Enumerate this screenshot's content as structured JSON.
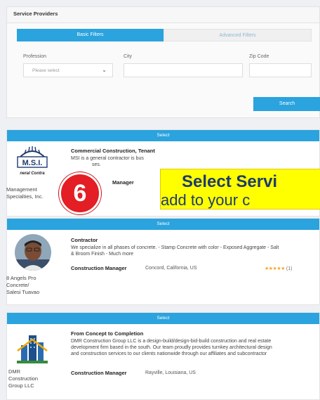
{
  "header": {
    "title": "Service Providers"
  },
  "filters": {
    "tabs": [
      "Basic Filters",
      "Advanced Filters"
    ],
    "labels": {
      "profession": "Profession",
      "city": "City",
      "zip": "Zip Code"
    },
    "profession_value": "Please select",
    "search_label": "Search"
  },
  "providers": [
    {
      "select_label": "Select",
      "title": "Commercial Construction, Tenant",
      "description_lines": [
        "MSI is a general contractor is bus",
        "ses."
      ],
      "role": "Manager",
      "company_lines": [
        "Management",
        "Specialties, Inc."
      ],
      "logo_name": "msi-logo"
    },
    {
      "select_label": "Select",
      "title": "Contractor",
      "description_lines": [
        "We specialize in all phases of concrete. - Stamp Concrete with color - Exposed Aggregate - Salt",
        "& Broom Finish - Much more"
      ],
      "role": "Construction Manager",
      "location": "Concord, California, US",
      "stars": "★★★★★",
      "rating_count": "(1)",
      "company_lines": [
        "8 Angels Pro",
        "Concrete/",
        "Salesi Tuavao"
      ],
      "logo_name": "person-photo"
    },
    {
      "select_label": "Select",
      "title": "From Concept to Completion",
      "description_lines": [
        "DMR Construction Group LLC is a design-build/design-bid-build construction and real estate",
        "development firm based in the south. Our team proudly provides turnkey architectural design",
        "and construction services to our clients nationwide through our affiliates and subcontractor"
      ],
      "role": "Construction Manager",
      "location": "Rayville, Louisiana, US",
      "company_lines": [
        "DMR",
        "Construction",
        "Group LLC"
      ],
      "logo_name": "dmr-logo"
    }
  ],
  "msi_logo_text": {
    "top": "M.S.I.",
    "bottom": "neral Contra"
  },
  "overlay": {
    "line1": "Select Servi",
    "line2": "add to your c",
    "step_number": "6"
  },
  "colors": {
    "accent": "#2aa3de",
    "highlight": "#ffff00",
    "badge": "#e31e24",
    "navy": "#1f3b6e",
    "star": "#f5a623"
  }
}
